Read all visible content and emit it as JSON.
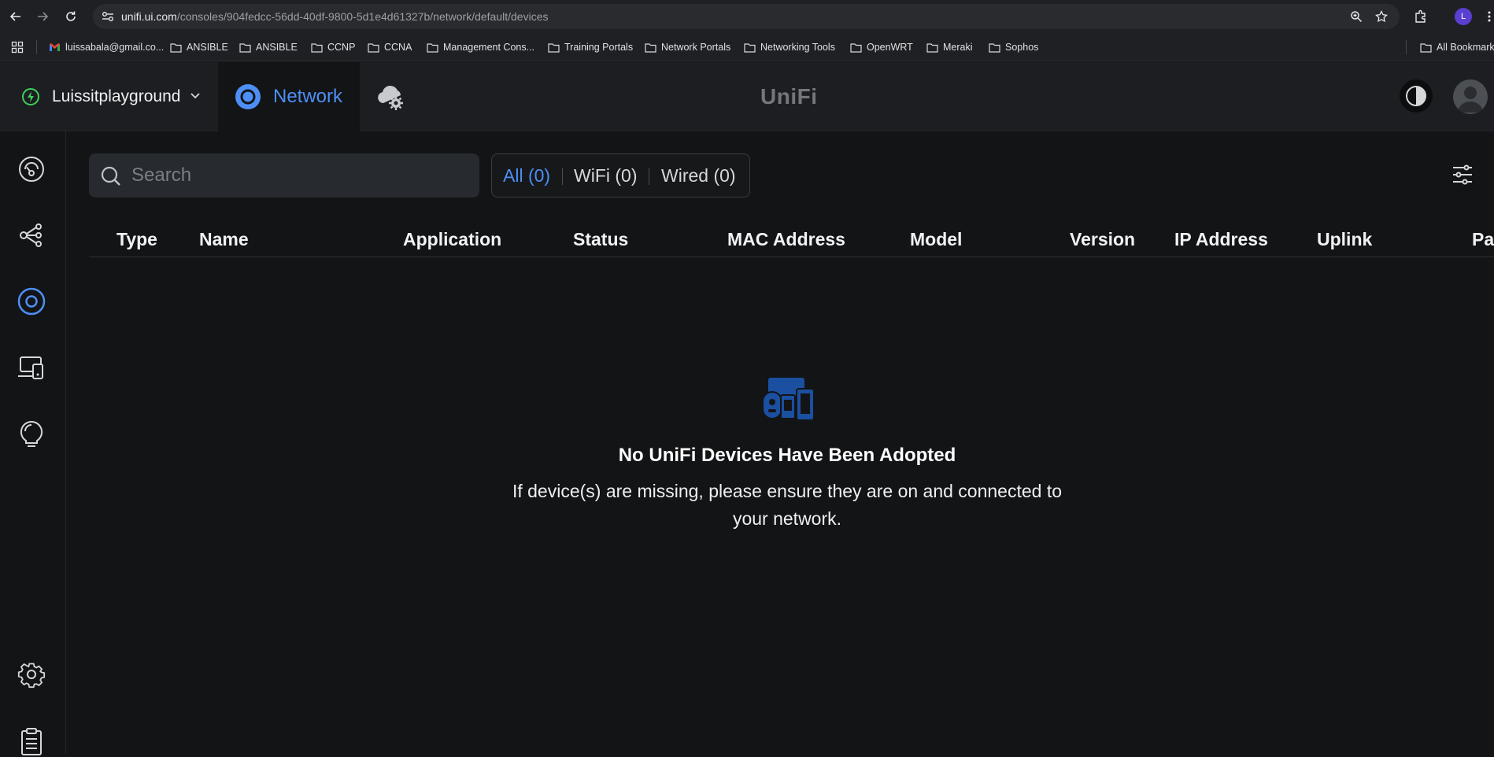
{
  "browser": {
    "url_host": "unifi.ui.com",
    "url_path": "/consoles/904fedcc-56dd-40df-9800-5d1e4d61327b/network/default/devices",
    "profile_initial": "L",
    "bookmarks": [
      "luissabala@gmail.co...",
      "ANSIBLE",
      "ANSIBLE",
      "CCNP",
      "CCNA",
      "Management Cons...",
      "Training Portals",
      "Network Portals",
      "Networking Tools",
      "OpenWRT",
      "Meraki",
      "Sophos"
    ],
    "all_bookmarks_label": "All Bookmarks"
  },
  "header": {
    "site_name": "Luissitplayground",
    "app_tab_label": "Network",
    "logo_text": "UniFi"
  },
  "toolbar": {
    "search_placeholder": "Search",
    "filters": [
      {
        "label": "All (0)",
        "active": true
      },
      {
        "label": "WiFi (0)",
        "active": false
      },
      {
        "label": "Wired (0)",
        "active": false
      }
    ]
  },
  "table": {
    "columns": [
      "Type",
      "Name",
      "Application",
      "Status",
      "MAC Address",
      "Model",
      "Version",
      "IP Address",
      "Uplink",
      "Pa"
    ]
  },
  "empty_state": {
    "title": "No UniFi Devices Have Been Adopted",
    "description": "If device(s) are missing, please ensure they are on and connected to your network."
  },
  "colors": {
    "accent": "#4d8ff5",
    "background": "#131416",
    "header_bg": "#1c1e21",
    "status_green": "#3ecf5d"
  }
}
